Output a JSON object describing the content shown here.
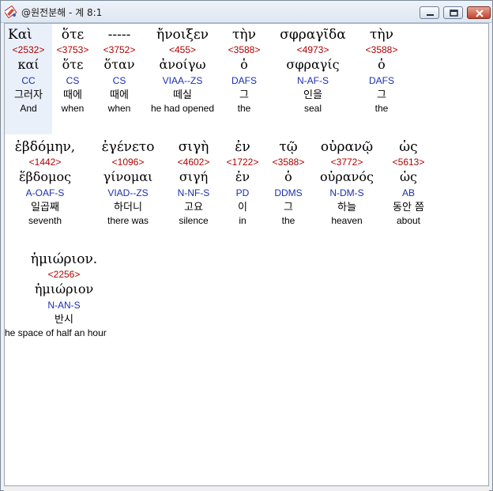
{
  "window": {
    "title": "@원전분해 - 계 8:1",
    "minimize_label": "minimize",
    "maximize_label": "maximize",
    "close_label": "close"
  },
  "words": [
    {
      "greek": "Καὶ",
      "strong": "<2532>",
      "lemma": "καί",
      "parse": "CC",
      "korean": "그러자",
      "english": "And"
    },
    {
      "greek": "ὅτε",
      "strong": "<3753>",
      "lemma": "ὅτε",
      "parse": "CS",
      "korean": "때에",
      "english": "when"
    },
    {
      "greek": "-----",
      "strong": "<3752>",
      "lemma": "ὅταν",
      "parse": "CS",
      "korean": "때에",
      "english": "when"
    },
    {
      "greek": "ἤνοιξεν",
      "strong": "<455>",
      "lemma": "ἀνοίγω",
      "parse": "VIAA--ZS",
      "korean": "떼실",
      "english": "he had opened"
    },
    {
      "greek": "τὴν",
      "strong": "<3588>",
      "lemma": "ὁ",
      "parse": "DAFS",
      "korean": "그",
      "english": "the"
    },
    {
      "greek": "σφραγῖδα",
      "strong": "<4973>",
      "lemma": "σφραγίς",
      "parse": "N-AF-S",
      "korean": "인을",
      "english": "seal"
    },
    {
      "greek": "τὴν",
      "strong": "<3588>",
      "lemma": "ὁ",
      "parse": "DAFS",
      "korean": "그",
      "english": "the"
    },
    {
      "greek": "ἑβδόμην,",
      "strong": "<1442>",
      "lemma": "ἕβδομος",
      "parse": "A-OAF-S",
      "korean": "일곱째",
      "english": "seventh"
    },
    {
      "greek": "ἐγένετο",
      "strong": "<1096>",
      "lemma": "γίνομαι",
      "parse": "VIAD--ZS",
      "korean": "하더니",
      "english": "there was"
    },
    {
      "greek": "σιγὴ",
      "strong": "<4602>",
      "lemma": "σιγή",
      "parse": "N-NF-S",
      "korean": "고요",
      "english": "silence"
    },
    {
      "greek": "ἐν",
      "strong": "<1722>",
      "lemma": "ἐν",
      "parse": "PD",
      "korean": "이",
      "english": "in"
    },
    {
      "greek": "τῷ",
      "strong": "<3588>",
      "lemma": "ὁ",
      "parse": "DDMS",
      "korean": "그",
      "english": "the"
    },
    {
      "greek": "οὐρανῷ",
      "strong": "<3772>",
      "lemma": "οὐρανός",
      "parse": "N-DM-S",
      "korean": "하늘",
      "english": "heaven"
    },
    {
      "greek": "ὡς",
      "strong": "<5613>",
      "lemma": "ὡς",
      "parse": "AB",
      "korean": "동안 쯤",
      "english": "about"
    },
    {
      "greek": "ἡμιώριον.",
      "strong": "<2256>",
      "lemma": "ἡμιώριον",
      "parse": "N-AN-S",
      "korean": "반시",
      "english": "he space of half an hour"
    }
  ]
}
